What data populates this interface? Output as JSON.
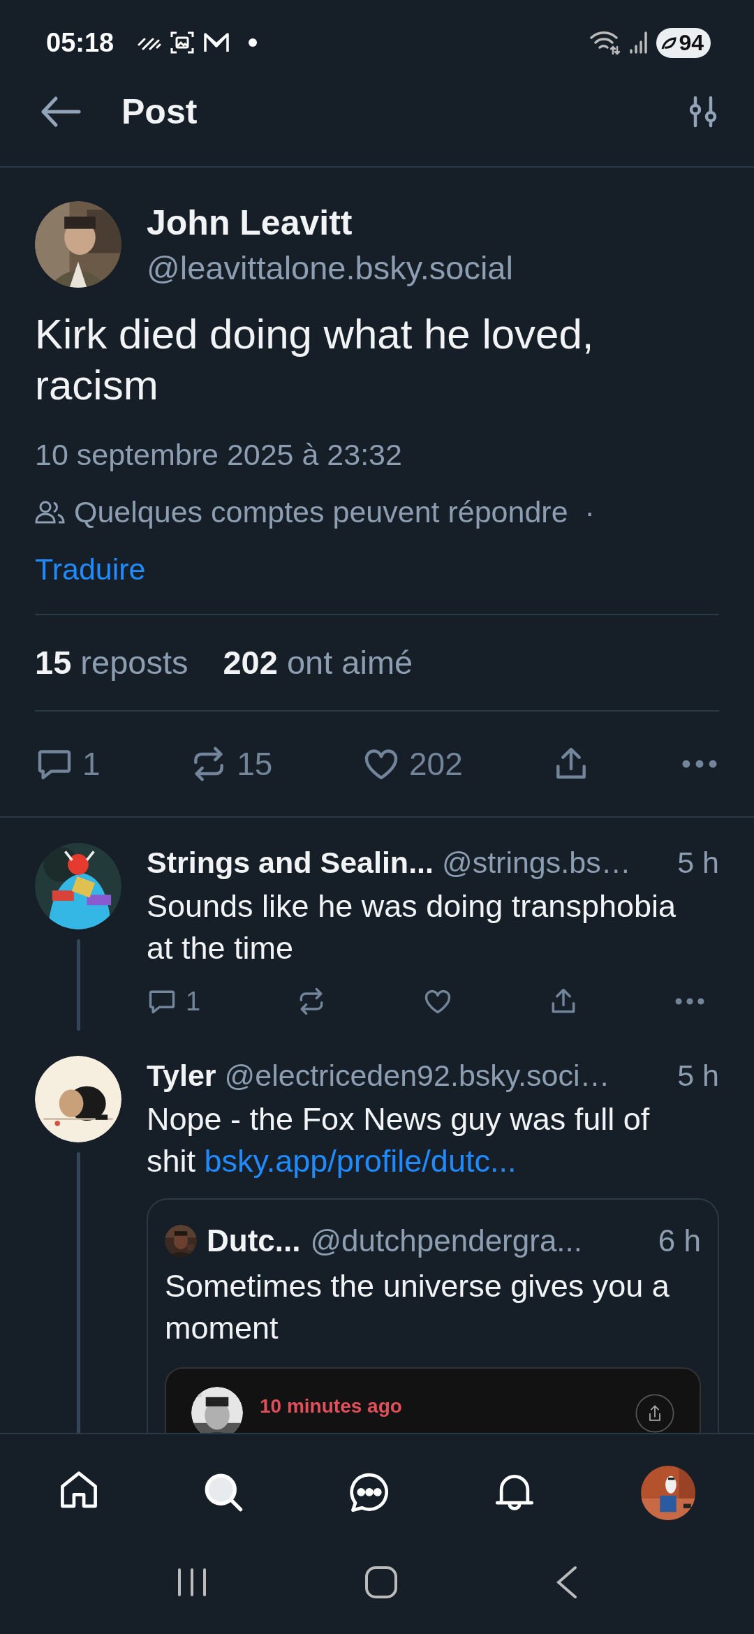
{
  "status_bar": {
    "time": "05:18",
    "battery": "94"
  },
  "header": {
    "title": "Post"
  },
  "post": {
    "author": "John Leavitt",
    "handle": "@leavittalone.bsky.social",
    "text": "Kirk died doing what he loved, racism",
    "date": "10 septembre 2025 à 23:32",
    "reply_setting": "Quelques comptes peuvent répondre",
    "separator": "·",
    "translate": "Traduire",
    "stats": [
      {
        "count": "15",
        "label": "reposts"
      },
      {
        "count": "202",
        "label": "ont aimé"
      }
    ],
    "actions": [
      {
        "kind": "reply",
        "count": "1"
      },
      {
        "kind": "repost",
        "count": "15"
      },
      {
        "kind": "like",
        "count": "202"
      },
      {
        "kind": "share"
      },
      {
        "kind": "more"
      }
    ]
  },
  "replies": [
    {
      "author": "Strings and Sealin...",
      "handle": "@strings.bs…",
      "time": "5 h",
      "text": "Sounds like he was doing transphobia at the time",
      "actions": [
        {
          "kind": "reply",
          "count": "1"
        },
        {
          "kind": "repost"
        },
        {
          "kind": "like"
        },
        {
          "kind": "share"
        },
        {
          "kind": "more"
        }
      ]
    },
    {
      "author": "Tyler",
      "handle": "@electriceden92.bsky.soci…",
      "time": "5 h",
      "text": "Nope - the Fox News guy was full of shit",
      "link": "bsky.app/profile/dutc...",
      "quote": {
        "author": "Dutc...",
        "handle": "@dutchpendergra...",
        "time": "6 h",
        "text": "Sometimes the universe gives you a moment",
        "embed": {
          "label": "10 minutes ago"
        }
      }
    }
  ],
  "bottom_nav": [
    {
      "kind": "home",
      "selected": false
    },
    {
      "kind": "search",
      "selected": true
    },
    {
      "kind": "chat",
      "selected": false
    },
    {
      "kind": "notifications",
      "selected": false
    },
    {
      "kind": "profile",
      "selected": false
    }
  ]
}
